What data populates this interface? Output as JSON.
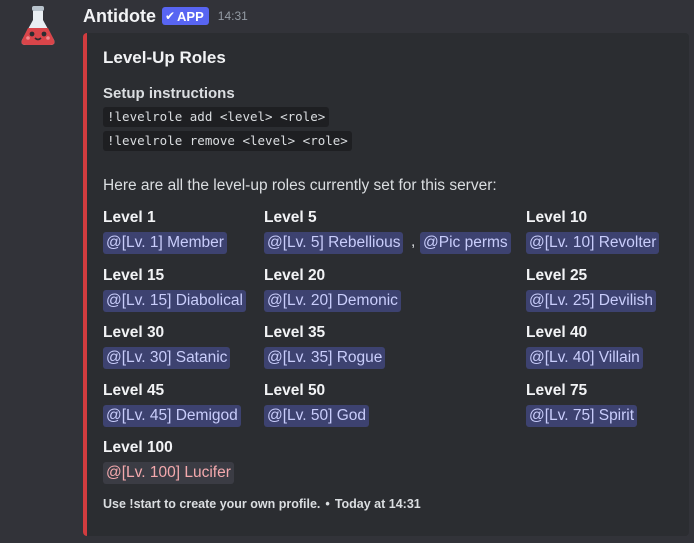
{
  "message": {
    "username": "Antidote",
    "badge": "APP",
    "timestamp": "14:31"
  },
  "embed": {
    "accent_color": "#d13c3f",
    "title": "Level-Up Roles",
    "setup_title": "Setup instructions",
    "commands": [
      "!levelrole add <level> <role>",
      "!levelrole remove <level> <role>"
    ],
    "intro": "Here are all the level-up roles currently set for this server:",
    "levels": [
      {
        "label": "Level 1",
        "roles": [
          "@[Lv. 1] Member"
        ]
      },
      {
        "label": "Level 5",
        "roles": [
          "@[Lv. 5] Rebellious",
          "@Pic perms"
        ]
      },
      {
        "label": "Level 10",
        "roles": [
          "@[Lv. 10] Revolter"
        ]
      },
      {
        "label": "Level 15",
        "roles": [
          "@[Lv. 15] Diabolical"
        ]
      },
      {
        "label": "Level 20",
        "roles": [
          "@[Lv. 20] Demonic"
        ]
      },
      {
        "label": "Level 25",
        "roles": [
          "@[Lv. 25] Devilish"
        ]
      },
      {
        "label": "Level 30",
        "roles": [
          "@[Lv. 30] Satanic"
        ]
      },
      {
        "label": "Level 35",
        "roles": [
          "@[Lv. 35] Rogue"
        ]
      },
      {
        "label": "Level 40",
        "roles": [
          "@[Lv. 40] Villain"
        ]
      },
      {
        "label": "Level 45",
        "roles": [
          "@[Lv. 45] Demigod"
        ]
      },
      {
        "label": "Level 50",
        "roles": [
          "@[Lv. 50] God"
        ]
      },
      {
        "label": "Level 75",
        "roles": [
          "@[Lv. 75] Spirit"
        ]
      },
      {
        "label": "Level 100",
        "roles": [
          "@[Lv. 100] Lucifer"
        ]
      }
    ],
    "role_separator": ",",
    "footer": {
      "text": "Use !start to create your own profile.",
      "separator": "•",
      "time": "Today at 14:31"
    }
  }
}
